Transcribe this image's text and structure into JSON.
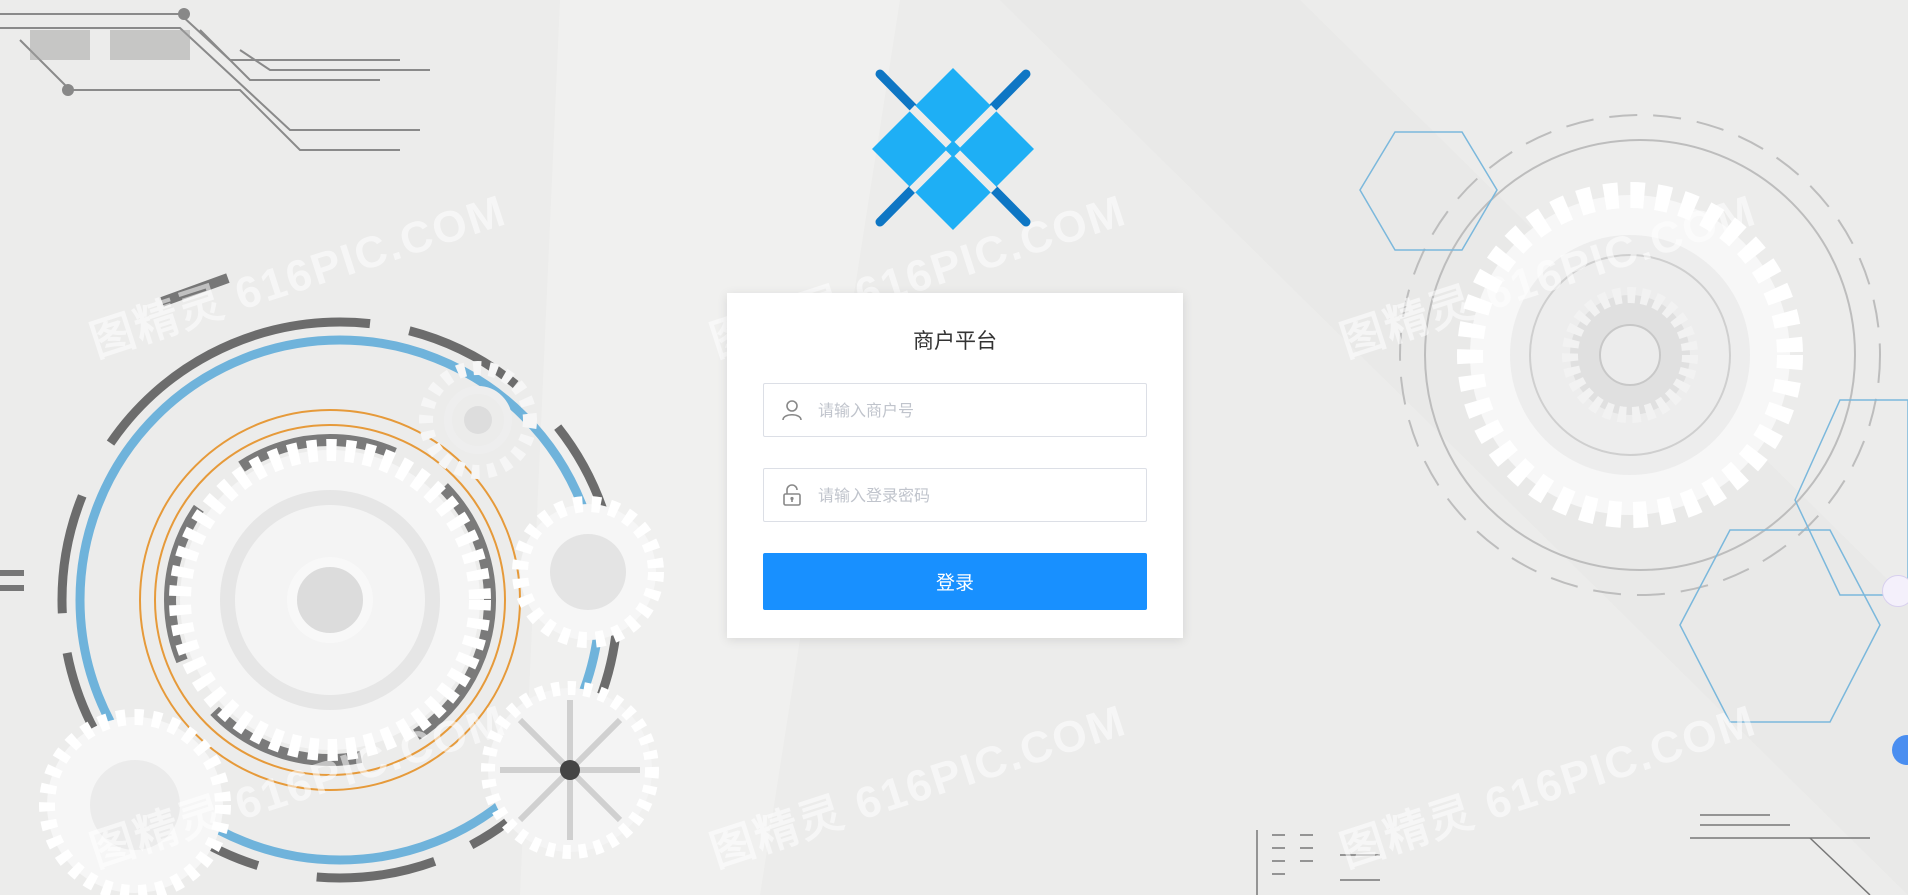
{
  "watermark_text": "图精灵 616PIC.COM",
  "logo": {
    "icon": "x-diamond-logo-icon",
    "colors": {
      "primary": "#1eaff5",
      "secondary": "#0e76c4"
    }
  },
  "login": {
    "title": "商户平台",
    "merchant_field": {
      "icon": "user-icon",
      "placeholder": "请输入商户号",
      "value": ""
    },
    "password_field": {
      "icon": "lock-icon",
      "placeholder": "请输入登录密码",
      "value": ""
    },
    "submit_label": "登录"
  },
  "colors": {
    "accent": "#1890ff",
    "background": "#ececeb"
  }
}
